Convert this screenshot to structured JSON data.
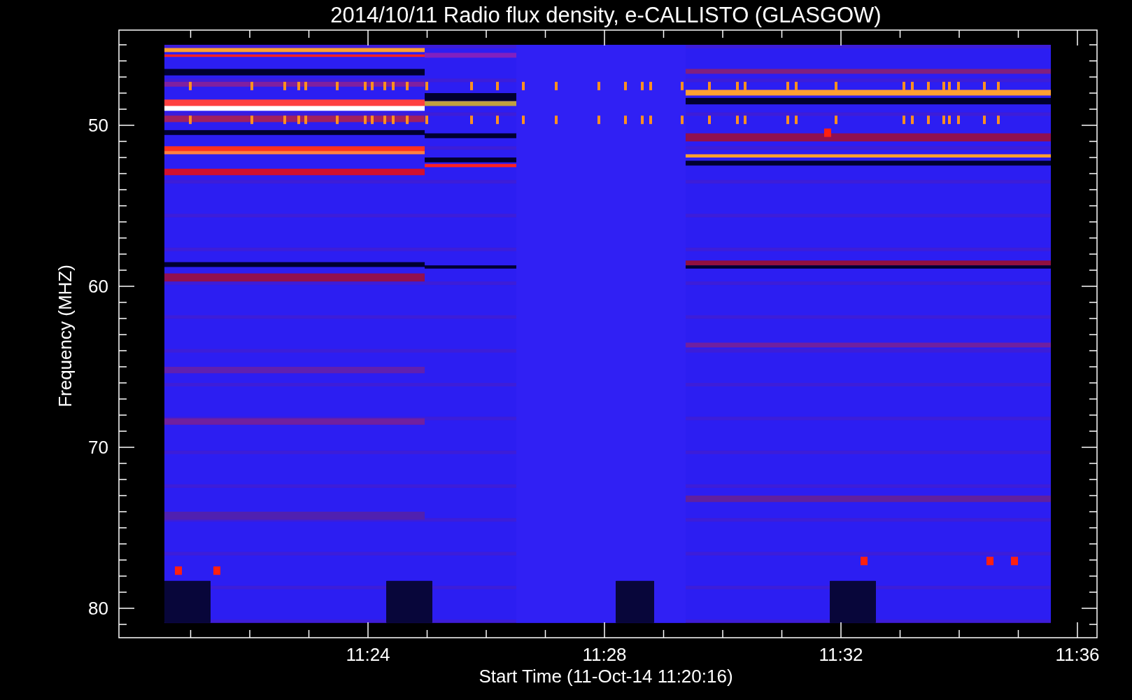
{
  "title": "2014/10/11  Radio flux density, e-CALLISTO (GLASGOW)",
  "y_axis": {
    "label": "Frequency (MHZ)",
    "tick_labels": [
      "50",
      "60",
      "70",
      "80"
    ]
  },
  "x_axis": {
    "label": "Start Time (11-Oct-14 11:20:16)",
    "tick_labels": [
      "11:24",
      "11:28",
      "11:32",
      "11:36"
    ]
  }
}
